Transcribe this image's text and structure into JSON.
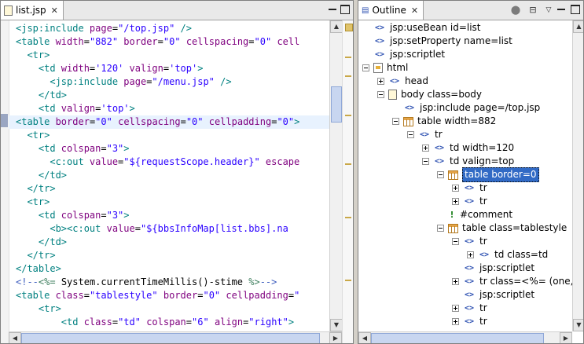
{
  "editor": {
    "tab_label": "list.jsp",
    "close_glyph": "✕",
    "lines": [
      {
        "segments": [
          [
            "t",
            "<jsp:include "
          ],
          [
            "a",
            "page"
          ],
          [
            "c",
            "="
          ],
          [
            "v",
            "\"/top.jsp\""
          ],
          [
            "t",
            " />"
          ]
        ]
      },
      {
        "segments": [
          [
            "t",
            "<table "
          ],
          [
            "a",
            "width"
          ],
          [
            "c",
            "="
          ],
          [
            "v",
            "\"882\""
          ],
          [
            "t",
            " "
          ],
          [
            "a",
            "border"
          ],
          [
            "c",
            "="
          ],
          [
            "v",
            "\"0\""
          ],
          [
            "t",
            " "
          ],
          [
            "a",
            "cellspacing"
          ],
          [
            "c",
            "="
          ],
          [
            "v",
            "\"0\""
          ],
          [
            "t",
            " "
          ],
          [
            "a",
            "cell"
          ]
        ]
      },
      {
        "segments": [
          [
            "t",
            "  <tr>"
          ]
        ]
      },
      {
        "segments": [
          [
            "t",
            "    <td "
          ],
          [
            "a",
            "width"
          ],
          [
            "c",
            "="
          ],
          [
            "v",
            "'120'"
          ],
          [
            "t",
            " "
          ],
          [
            "a",
            "valign"
          ],
          [
            "c",
            "="
          ],
          [
            "v",
            "'top'"
          ],
          [
            "t",
            ">"
          ]
        ]
      },
      {
        "segments": [
          [
            "t",
            "      <jsp:include "
          ],
          [
            "a",
            "page"
          ],
          [
            "c",
            "="
          ],
          [
            "v",
            "\"/menu.jsp\""
          ],
          [
            "t",
            " />"
          ]
        ]
      },
      {
        "segments": [
          [
            "t",
            "    </td>"
          ]
        ]
      },
      {
        "segments": [
          [
            "t",
            "    <td "
          ],
          [
            "a",
            "valign"
          ],
          [
            "c",
            "="
          ],
          [
            "v",
            "'top'"
          ],
          [
            "t",
            ">"
          ]
        ]
      },
      {
        "segments": [
          [
            "t",
            "<table "
          ],
          [
            "a",
            "border"
          ],
          [
            "c",
            "="
          ],
          [
            "v",
            "\"0\""
          ],
          [
            "t",
            " "
          ],
          [
            "a",
            "cellspacing"
          ],
          [
            "c",
            "="
          ],
          [
            "v",
            "\"0\""
          ],
          [
            "t",
            " "
          ],
          [
            "a",
            "cellpadding"
          ],
          [
            "c",
            "="
          ],
          [
            "v",
            "\"0\""
          ],
          [
            "t",
            ">"
          ]
        ],
        "hl": true
      },
      {
        "segments": [
          [
            "t",
            "  <tr>"
          ]
        ]
      },
      {
        "segments": [
          [
            "t",
            "    <td "
          ],
          [
            "a",
            "colspan"
          ],
          [
            "c",
            "="
          ],
          [
            "v",
            "\"3\""
          ],
          [
            "t",
            ">"
          ]
        ]
      },
      {
        "segments": [
          [
            "t",
            "      <c:out "
          ],
          [
            "a",
            "value"
          ],
          [
            "c",
            "="
          ],
          [
            "v",
            "\"${requestScope.header}\""
          ],
          [
            "t",
            " "
          ],
          [
            "a",
            "escape"
          ]
        ]
      },
      {
        "segments": [
          [
            "t",
            "    </td>"
          ]
        ]
      },
      {
        "segments": [
          [
            "t",
            "  </tr>"
          ]
        ]
      },
      {
        "segments": [
          [
            "t",
            "  <tr>"
          ]
        ]
      },
      {
        "segments": [
          [
            "t",
            "    <td "
          ],
          [
            "a",
            "colspan"
          ],
          [
            "c",
            "="
          ],
          [
            "v",
            "\"3\""
          ],
          [
            "t",
            ">"
          ]
        ]
      },
      {
        "segments": [
          [
            "t",
            "      <b><c:out "
          ],
          [
            "a",
            "value"
          ],
          [
            "c",
            "="
          ],
          [
            "v",
            "\"${bbsInfoMap[list.bbs].na"
          ]
        ]
      },
      {
        "segments": [
          [
            "t",
            "    </td>"
          ]
        ]
      },
      {
        "segments": [
          [
            "t",
            "  </tr>"
          ]
        ]
      },
      {
        "segments": [
          [
            "t",
            "</table>"
          ]
        ]
      },
      {
        "segments": [
          [
            "cm",
            "<!--"
          ],
          [
            "k",
            "<%="
          ],
          [
            "c",
            " System.currentTimeMillis()-stime "
          ],
          [
            "k",
            "%>"
          ],
          [
            "cm",
            "-->"
          ]
        ]
      },
      {
        "segments": [
          [
            "t",
            "<table "
          ],
          [
            "a",
            "class"
          ],
          [
            "c",
            "="
          ],
          [
            "v",
            "\"tablestyle\""
          ],
          [
            "t",
            " "
          ],
          [
            "a",
            "border"
          ],
          [
            "c",
            "="
          ],
          [
            "v",
            "\"0\""
          ],
          [
            "t",
            " "
          ],
          [
            "a",
            "cellpadding"
          ],
          [
            "c",
            "="
          ],
          [
            "v",
            "\""
          ]
        ]
      },
      {
        "segments": [
          [
            "t",
            "    <tr>"
          ]
        ]
      },
      {
        "segments": [
          [
            "t",
            "        <td "
          ],
          [
            "a",
            "class"
          ],
          [
            "c",
            "="
          ],
          [
            "v",
            "\"td\""
          ],
          [
            "t",
            " "
          ],
          [
            "a",
            "colspan"
          ],
          [
            "c",
            "="
          ],
          [
            "v",
            "\"6\""
          ],
          [
            "t",
            " "
          ],
          [
            "a",
            "align"
          ],
          [
            "c",
            "="
          ],
          [
            "v",
            "\"right\""
          ],
          [
            "t",
            ">"
          ]
        ]
      }
    ]
  },
  "outline": {
    "tab_label": "Outline",
    "close_glyph": "✕",
    "nodes": [
      {
        "label": "jsp:useBean id=list",
        "icon": "tag",
        "exp": "none",
        "depth": 1
      },
      {
        "label": "jsp:setProperty name=list",
        "icon": "tag",
        "exp": "none",
        "depth": 1
      },
      {
        "label": "jsp:scriptlet",
        "icon": "tag",
        "exp": "none",
        "depth": 1
      },
      {
        "label": "html",
        "icon": "doc",
        "exp": "minus",
        "depth": 1
      },
      {
        "label": "head",
        "icon": "tag",
        "exp": "plus",
        "depth": 2
      },
      {
        "label": "body class=body",
        "icon": "page",
        "exp": "minus",
        "depth": 2
      },
      {
        "label": "jsp:include page=/top.jsp",
        "icon": "tag",
        "exp": "none",
        "depth": 3
      },
      {
        "label": "table width=882",
        "icon": "table",
        "exp": "minus",
        "depth": 3
      },
      {
        "label": "tr",
        "icon": "tag",
        "exp": "minus",
        "depth": 4
      },
      {
        "label": "td width=120",
        "icon": "tag",
        "exp": "plus",
        "depth": 5
      },
      {
        "label": "td valign=top",
        "icon": "tag",
        "exp": "minus",
        "depth": 5
      },
      {
        "label": "table border=0",
        "icon": "table",
        "exp": "minus",
        "depth": 6,
        "selected": true
      },
      {
        "label": "tr",
        "icon": "tag",
        "exp": "plus",
        "depth": 7
      },
      {
        "label": "tr",
        "icon": "tag",
        "exp": "plus",
        "depth": 7
      },
      {
        "label": "#comment",
        "icon": "comment",
        "exp": "none",
        "depth": 6
      },
      {
        "label": "table class=tablestyle",
        "icon": "table",
        "exp": "minus",
        "depth": 6
      },
      {
        "label": "tr",
        "icon": "tag",
        "exp": "minus",
        "depth": 7
      },
      {
        "label": "td class=td",
        "icon": "tag",
        "exp": "plus",
        "depth": 8
      },
      {
        "label": "jsp:scriptlet",
        "icon": "tag",
        "exp": "none",
        "depth": 7
      },
      {
        "label": "tr class=<%= (one,g",
        "icon": "tag",
        "exp": "plus",
        "depth": 7
      },
      {
        "label": "jsp:scriptlet",
        "icon": "tag",
        "exp": "none",
        "depth": 7
      },
      {
        "label": "tr",
        "icon": "tag",
        "exp": "plus",
        "depth": 7
      },
      {
        "label": "tr",
        "icon": "tag",
        "exp": "plus",
        "depth": 7
      }
    ]
  },
  "icons": {
    "tag_glyph": "<>",
    "comment_glyph": "!--",
    "toolbar": [
      "link-with-editor-icon",
      "collapse-all-icon",
      "view-menu-icon"
    ]
  }
}
